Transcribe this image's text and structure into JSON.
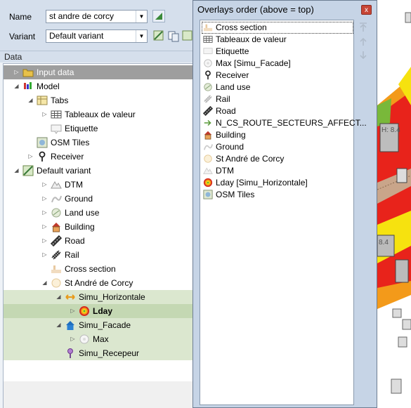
{
  "form": {
    "name_label": "Name",
    "name_value": "st andre de corcy",
    "variant_label": "Variant",
    "variant_value": "Default variant"
  },
  "data_panel": {
    "header": "Data",
    "tree": [
      {
        "label": "Input data"
      },
      {
        "label": "Model"
      },
      {
        "label": "Tabs"
      },
      {
        "label": "Tableaux de valeur"
      },
      {
        "label": "Etiquette"
      },
      {
        "label": "OSM Tiles"
      },
      {
        "label": "Receiver"
      },
      {
        "label": "Default variant"
      },
      {
        "label": "DTM"
      },
      {
        "label": "Ground"
      },
      {
        "label": "Land use"
      },
      {
        "label": "Building"
      },
      {
        "label": "Road"
      },
      {
        "label": "Rail"
      },
      {
        "label": "Cross section"
      },
      {
        "label": "St André de Corcy"
      },
      {
        "label": "Simu_Horizontale"
      },
      {
        "label": "Lday"
      },
      {
        "label": "Simu_Facade"
      },
      {
        "label": "Max"
      },
      {
        "label": "Simu_Recepeur"
      }
    ]
  },
  "overlays": {
    "title": "Overlays order (above = top)",
    "close_symbol": "x",
    "items": [
      {
        "label": "Cross section",
        "icon": "cross-section-icon"
      },
      {
        "label": "Tableaux de valeur",
        "icon": "table-icon"
      },
      {
        "label": "Etiquette",
        "icon": "label-icon"
      },
      {
        "label": "Max [Simu_Facade]",
        "icon": "max-icon"
      },
      {
        "label": "Receiver",
        "icon": "receiver-icon"
      },
      {
        "label": "Land use",
        "icon": "land-use-icon"
      },
      {
        "label": "Rail",
        "icon": "rail-icon"
      },
      {
        "label": "Road",
        "icon": "road-icon"
      },
      {
        "label": "N_CS_ROUTE_SECTEURS_AFFECT...",
        "icon": "arrow-layer-icon"
      },
      {
        "label": "Building",
        "icon": "building-icon"
      },
      {
        "label": "Ground",
        "icon": "ground-icon"
      },
      {
        "label": "St André de Corcy",
        "icon": "area-icon"
      },
      {
        "label": "DTM",
        "icon": "dtm-icon"
      },
      {
        "label": "Lday [Simu_Horizontale]",
        "icon": "lday-icon"
      },
      {
        "label": "OSM Tiles",
        "icon": "osm-tiles-icon"
      }
    ]
  },
  "map": {
    "labels": [
      "H: 8.4",
      "8.4"
    ]
  },
  "colors": {
    "selection": "#c4d8b3",
    "map_red": "#e8231b",
    "map_yellow": "#f6e20f",
    "map_orange": "#f39a1a",
    "map_green": "#79b83a"
  }
}
